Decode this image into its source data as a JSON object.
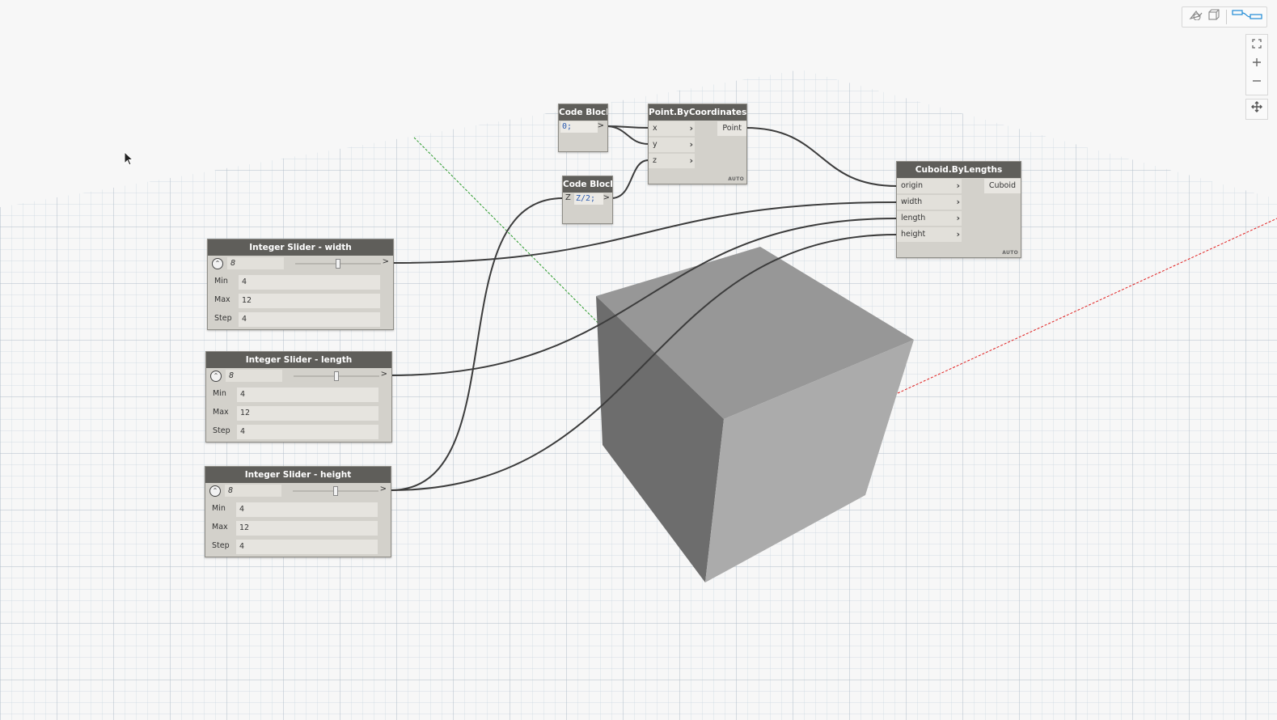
{
  "nodes": {
    "code_block_1": {
      "title": "Code Block",
      "code": "0;",
      "output_arrow": ">"
    },
    "code_block_2": {
      "title": "Code Block",
      "input": "Z",
      "code": "Z/2;",
      "output_arrow": ">"
    },
    "point_by_coordinates": {
      "title": "Point.ByCoordinates",
      "inputs": [
        "x",
        "y",
        "z"
      ],
      "output": "Point",
      "lacing": "AUTO"
    },
    "cuboid_by_lengths": {
      "title": "Cuboid.ByLengths",
      "inputs": [
        "origin",
        "width",
        "length",
        "height"
      ],
      "output": "Cuboid",
      "lacing": "AUTO"
    },
    "slider_width": {
      "title": "Integer Slider - width",
      "value": "8",
      "min_label": "Min",
      "min": "4",
      "max_label": "Max",
      "max": "12",
      "step_label": "Step",
      "step": "4",
      "level": 0.5,
      "output_arrow": ">"
    },
    "slider_length": {
      "title": "Integer Slider - length",
      "value": "8",
      "min_label": "Min",
      "min": "4",
      "max_label": "Max",
      "max": "12",
      "step_label": "Step",
      "step": "4",
      "level": 0.5,
      "output_arrow": ">"
    },
    "slider_height": {
      "title": "Integer Slider - height",
      "value": "8",
      "min_label": "Min",
      "min": "4",
      "max_label": "Max",
      "max": "12",
      "step_label": "Step",
      "step": "4",
      "level": 0.5,
      "output_arrow": ">"
    }
  },
  "view_controls": {
    "icons": [
      "geometry-view-icon",
      "graph-view-icon",
      "zoom-to-fit-icon",
      "zoom-in-icon",
      "zoom-out-icon",
      "pan-icon"
    ]
  },
  "colors": {
    "node_header": "#5f5e5a",
    "node_body": "#d3d1cb",
    "wire": "#3c3c3c",
    "x_axis": "#e02020",
    "y_axis": "#2a9a2a",
    "cube_top": "#979797",
    "cube_left": "#6d6d6d",
    "cube_right": "#ababab",
    "active_view": "#1e8ad6"
  }
}
